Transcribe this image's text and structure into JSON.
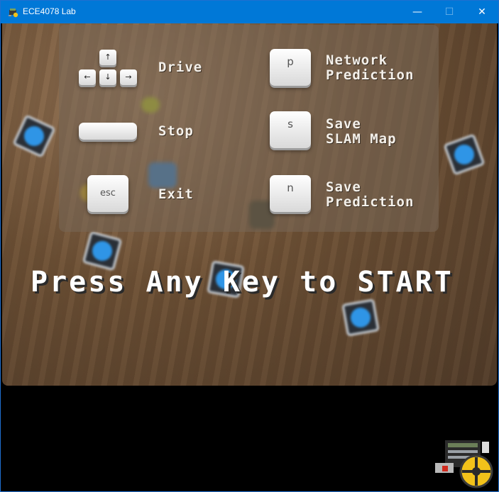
{
  "window": {
    "title": "ECE4078 Lab",
    "controls": {
      "minimize": "—",
      "maximize": "☐",
      "close": "✕"
    }
  },
  "icons": {
    "app": "robot-app-icon",
    "robot": "robot-sprite-icon"
  },
  "controls_panel": {
    "drive": {
      "label": "Drive",
      "keys": [
        "↑",
        "←",
        "↓",
        "→"
      ]
    },
    "stop": {
      "label": "Stop",
      "key": ""
    },
    "exit": {
      "label": "Exit",
      "key": "esc"
    },
    "network_prediction": {
      "label_line1": "Network",
      "label_line2": "Prediction",
      "key": "p"
    },
    "save_slam": {
      "label_line1": "Save",
      "label_line2": "SLAM Map",
      "key": "s"
    },
    "save_prediction": {
      "label_line1": "Save",
      "label_line2": "Prediction",
      "key": "n"
    }
  },
  "start_prompt": "Press Any Key to START",
  "colors": {
    "titlebar": "#0078d7",
    "cube_blue": "#2f95e6",
    "panel_text": "#f4f0ea"
  }
}
